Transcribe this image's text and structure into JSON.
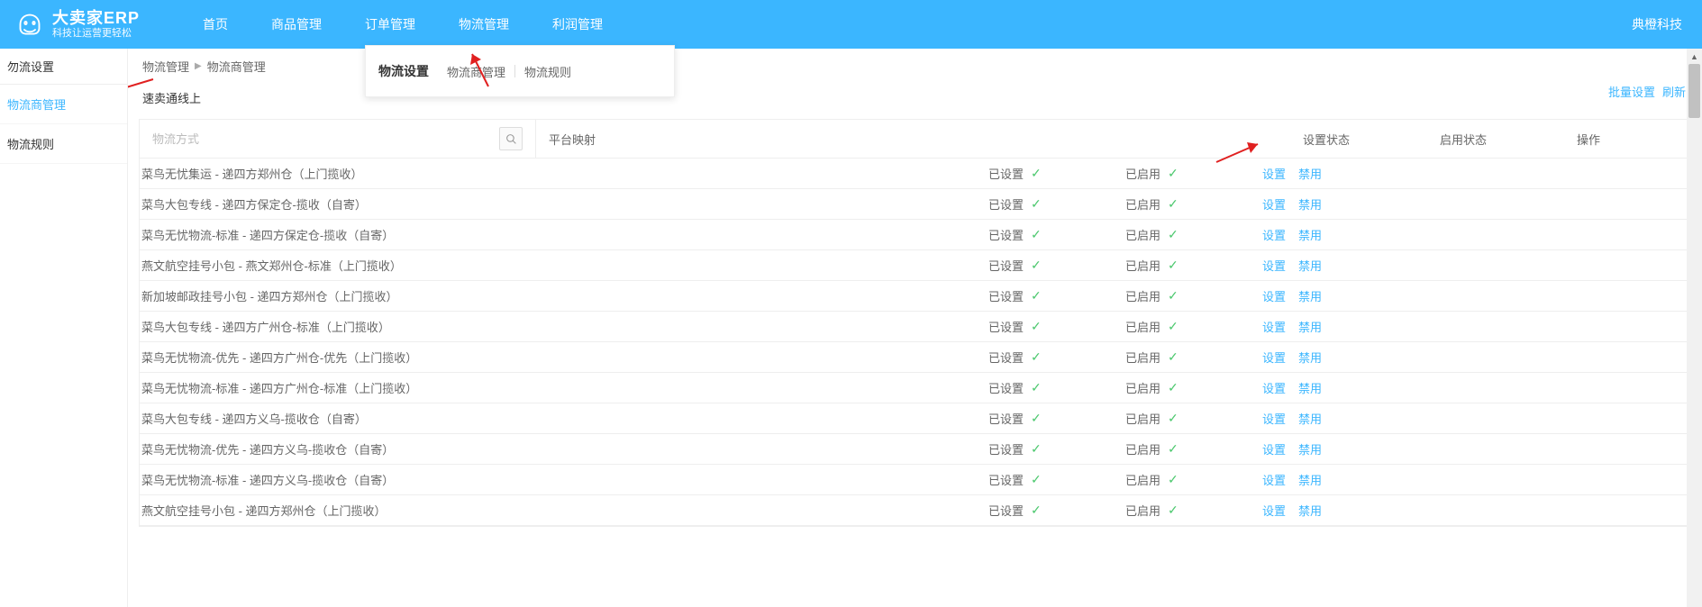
{
  "brand": {
    "title": "大卖家ERP",
    "subtitle": "科技让运营更轻松"
  },
  "nav": {
    "items": [
      "首页",
      "商品管理",
      "订单管理",
      "物流管理",
      "利润管理"
    ],
    "activeIndex": 3
  },
  "headerRight": {
    "company": "典橙科技"
  },
  "dropdown": {
    "title": "物流设置",
    "links": [
      "物流商管理",
      "物流规则"
    ]
  },
  "sidebar": {
    "header": "勿流设置",
    "items": [
      "物流商管理",
      "物流规则"
    ],
    "activeIndex": 0
  },
  "breadcrumb": [
    "物流管理",
    "物流商管理"
  ],
  "sectionTitle": "速卖通线上",
  "topLinks": {
    "batch": "批量设置",
    "refresh": "刷新"
  },
  "search": {
    "placeholder": "物流方式"
  },
  "tableHeaders": {
    "platform": "平台映射",
    "setStatus": "设置状态",
    "enableStatus": "启用状态",
    "op": "操作"
  },
  "statusLabels": {
    "set": "已设置",
    "enabled": "已启用"
  },
  "opLabels": {
    "config": "设置",
    "disable": "禁用"
  },
  "rows": [
    {
      "name": "菜鸟无忧集运 - 递四方郑州仓（上门揽收）"
    },
    {
      "name": "菜鸟大包专线 - 递四方保定仓-揽收（自寄）"
    },
    {
      "name": "菜鸟无忧物流-标准 - 递四方保定仓-揽收（自寄）"
    },
    {
      "name": "燕文航空挂号小包 - 燕文郑州仓-标准（上门揽收）"
    },
    {
      "name": "新加坡邮政挂号小包 - 递四方郑州仓（上门揽收）"
    },
    {
      "name": "菜鸟大包专线 - 递四方广州仓-标准（上门揽收）"
    },
    {
      "name": "菜鸟无忧物流-优先 - 递四方广州仓-优先（上门揽收）"
    },
    {
      "name": "菜鸟无忧物流-标准 - 递四方广州仓-标准（上门揽收）"
    },
    {
      "name": "菜鸟大包专线 - 递四方义乌-揽收仓（自寄）"
    },
    {
      "name": "菜鸟无忧物流-优先 - 递四方义乌-揽收仓（自寄）"
    },
    {
      "name": "菜鸟无忧物流-标准 - 递四方义乌-揽收仓（自寄）"
    },
    {
      "name": "燕文航空挂号小包 - 递四方郑州仓（上门揽收）"
    }
  ]
}
